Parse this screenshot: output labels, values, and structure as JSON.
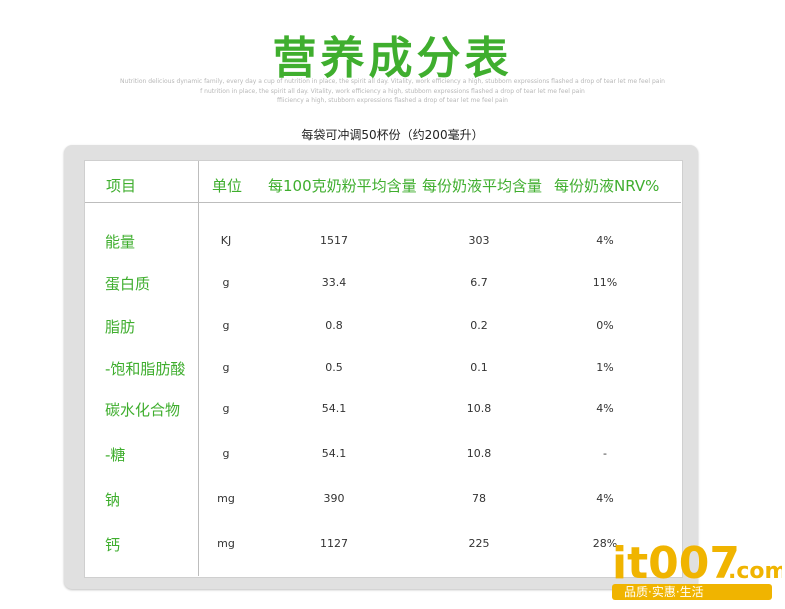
{
  "header": {
    "title": "营养成分表",
    "subtitle_lines": [
      "Nutrition delicious dynamic family, every day a cup of nutrition in place, the spirit all day. Vitality, work efficiency a high, stubborn expressions flashed a drop of tear let me feel pain",
      "f nutrition in place, the spirit all day. Vitality, work efficiency a high, stubborn expressions flashed a drop of tear let me feel pain",
      "ffiiciency a high, stubborn expressions flashed a drop of tear let me feel pain"
    ],
    "serving_note": "每袋可冲调50杯份（约200毫升）"
  },
  "table": {
    "columns": [
      "项目",
      "单位",
      "每100克奶粉平均含量",
      "每份奶液平均含量",
      "每份奶液NRV%"
    ],
    "rows": [
      {
        "item": "能量",
        "unit": "KJ",
        "per100g": "1517",
        "per_serving": "303",
        "nrv": "4%"
      },
      {
        "item": "蛋白质",
        "unit": "g",
        "per100g": "33.4",
        "per_serving": "6.7",
        "nrv": "11%"
      },
      {
        "item": "脂肪",
        "unit": "g",
        "per100g": "0.8",
        "per_serving": "0.2",
        "nrv": "0%"
      },
      {
        "item": "-饱和脂肪酸",
        "unit": "g",
        "per100g": "0.5",
        "per_serving": "0.1",
        "nrv": "1%"
      },
      {
        "item": "碳水化合物",
        "unit": "g",
        "per100g": "54.1",
        "per_serving": "10.8",
        "nrv": "4%"
      },
      {
        "item": "-糖",
        "unit": "g",
        "per100g": "54.1",
        "per_serving": "10.8",
        "nrv": "-"
      },
      {
        "item": "钠",
        "unit": "mg",
        "per100g": "390",
        "per_serving": "78",
        "nrv": "4%"
      },
      {
        "item": "钙",
        "unit": "mg",
        "per100g": "1127",
        "per_serving": "225",
        "nrv": "28%"
      }
    ]
  },
  "watermark": {
    "brand": "it007",
    "domain": ".com",
    "tagline": "品质·实惠·生活"
  },
  "colors": {
    "accent_green": "#3fae2e",
    "logo_yellow": "#f0b400",
    "logo_red": "#e03a1a"
  }
}
